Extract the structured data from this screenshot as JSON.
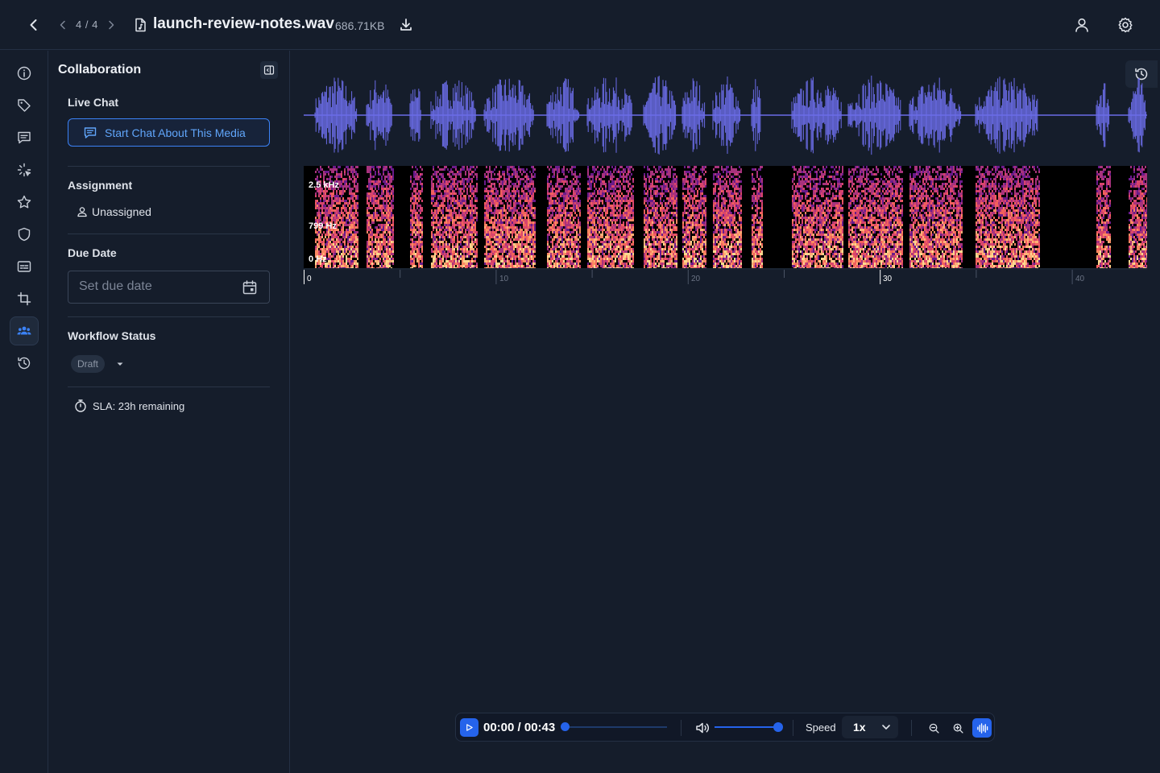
{
  "header": {
    "pager": "4 / 4",
    "filename": "launch-review-notes.wav",
    "filesize": "686.71KB"
  },
  "rail": {
    "items": [
      "info-icon",
      "tag-icon",
      "comment-icon",
      "sparkle-icon",
      "star-icon",
      "shield-icon",
      "subtitles-icon",
      "crop-icon",
      "people-icon",
      "history-icon"
    ],
    "active": "people-icon"
  },
  "panel": {
    "title": "Collaboration",
    "live_chat": {
      "label": "Live Chat",
      "button": "Start Chat About This Media"
    },
    "assignment": {
      "label": "Assignment",
      "value": "Unassigned"
    },
    "due_date": {
      "label": "Due Date",
      "placeholder": "Set due date"
    },
    "workflow_status": {
      "label": "Workflow Status",
      "value": "Draft"
    },
    "sla": "SLA: 23h remaining"
  },
  "spectrogram": {
    "freq_labels": [
      "2.5 kHz",
      "799 Hz",
      "0 Hz"
    ]
  },
  "timeline": {
    "labels": [
      "0",
      "10",
      "20",
      "30",
      "40"
    ]
  },
  "player": {
    "time": "00:00 / 00:43",
    "progress": 0,
    "volume": 1,
    "speed_label": "Speed",
    "speed_value": "1x"
  },
  "colors": {
    "accent": "#2563eb",
    "link": "#60a5fa",
    "waveform": "#6b6ce8",
    "background": "#151d2b"
  }
}
